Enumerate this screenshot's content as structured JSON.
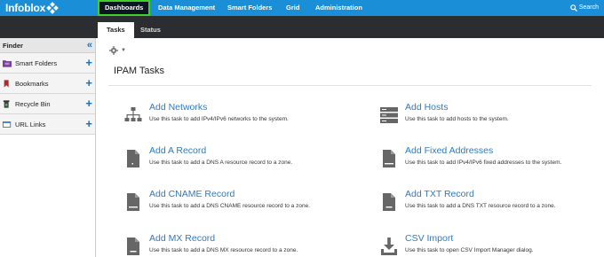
{
  "app": {
    "logo_text": "Infoblox"
  },
  "nav": {
    "items": [
      {
        "label": "Dashboards",
        "active": true
      },
      {
        "label": "Data Management"
      },
      {
        "label": "Smart Folders"
      },
      {
        "label": "Grid"
      },
      {
        "label": "Administration"
      }
    ],
    "search_label": "Search"
  },
  "tabs": [
    {
      "label": "Tasks",
      "active": true
    },
    {
      "label": "Status"
    }
  ],
  "sidebar": {
    "title": "Finder",
    "items": [
      {
        "label": "Smart Folders",
        "icon": "folder-icon"
      },
      {
        "label": "Bookmarks",
        "icon": "bookmark-icon"
      },
      {
        "label": "Recycle Bin",
        "icon": "recycle-bin-icon"
      },
      {
        "label": "URL Links",
        "icon": "link-icon"
      }
    ]
  },
  "main": {
    "title": "IPAM Tasks",
    "tasks": [
      {
        "name": "Add Networks",
        "desc": "Use this task to add IPv4/IPv6 networks to the system."
      },
      {
        "name": "Add Hosts",
        "desc": "Use this task to add hosts to the system."
      },
      {
        "name": "Add A Record",
        "desc": "Use this task to add a DNS A resource record to a zone."
      },
      {
        "name": "Add Fixed Addresses",
        "desc": "Use this task to add IPv4/IPv6 fixed addresses to the system."
      },
      {
        "name": "Add CNAME Record",
        "desc": "Use this task to add a DNS CNAME resource record to a zone."
      },
      {
        "name": "Add TXT Record",
        "desc": "Use this task to add a DNS TXT resource record to a zone."
      },
      {
        "name": "Add MX Record",
        "desc": "Use this task to add a DNS MX resource record to a zone."
      },
      {
        "name": "CSV Import",
        "desc": "Use this task to open CSV Import Manager dialog."
      }
    ]
  },
  "colors": {
    "brand_blue": "#1a8fd8",
    "link_blue": "#2e7ac2",
    "active_highlight": "#3dd12a",
    "tab_bar": "#2b2d30"
  }
}
